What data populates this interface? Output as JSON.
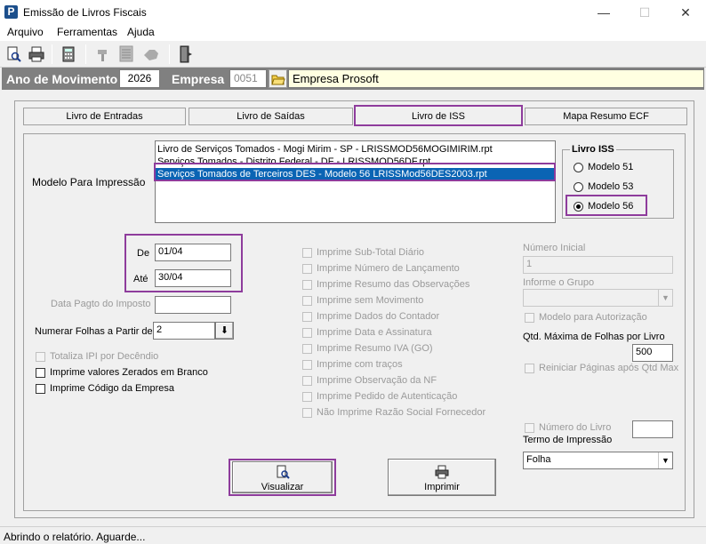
{
  "window": {
    "title": "Emissão de Livros Fiscais",
    "app_icon": "P",
    "minimize": "—",
    "maximize": "☐",
    "close": "✕"
  },
  "menu": [
    "Arquivo",
    "Ferramentas",
    "Ajuda"
  ],
  "toolbar": {
    "icons": [
      "preview-icon",
      "print-icon",
      "calculator-icon",
      "hammer-icon",
      "document-icon",
      "hand-icon",
      "exit-door-icon"
    ]
  },
  "header": {
    "ano_label": "Ano de Movimento",
    "ano_value": "2026",
    "empresa_label": "Empresa",
    "empresa_code": "0051",
    "empresa_name": "Empresa Prosoft"
  },
  "tabs": [
    "Livro de Entradas",
    "Livro de Saídas",
    "Livro de ISS",
    "Mapa Resumo ECF"
  ],
  "active_tab": "Livro de ISS",
  "modelo": {
    "label": "Modelo Para Impressão",
    "items": [
      "Livro de Serviços Tomados - Mogi Mirim - SP - LRISSMOD56MOGIMIRIM.rpt",
      "Serviços Tomados - Distrito Federal - DF - LRISSMOD56DF.rpt",
      "Serviços Tomados de Terceiros DES - Modelo 56  LRISSMod56DES2003.rpt"
    ],
    "selected_index": 2
  },
  "livro_iss": {
    "title": "Livro ISS",
    "options": [
      "Modelo 51",
      "Modelo 53",
      "Modelo 56"
    ],
    "selected": "Modelo 56"
  },
  "periodo": {
    "de_label": "De",
    "de_value": "01/04",
    "ate_label": "Até",
    "ate_value": "30/04"
  },
  "data_pagto": {
    "label": "Data Pagto do Imposto",
    "value": ""
  },
  "numerar": {
    "label": "Numerar Folhas a Partir de",
    "value": "2"
  },
  "left_checks": [
    {
      "label": "Totaliza IPI por Decêndio",
      "checked": false,
      "enabled": false
    },
    {
      "label": "Imprime valores Zerados em Branco",
      "checked": false,
      "enabled": true
    },
    {
      "label": "Imprime Código da Empresa",
      "checked": false,
      "enabled": true
    }
  ],
  "middle_checks": [
    "Imprime Sub-Total Diário",
    "Imprime Número de Lançamento",
    "Imprime Resumo das Observações",
    "Imprime sem Movimento",
    "Imprime Dados do Contador",
    "Imprime Data e Assinatura",
    "Imprime Resumo IVA (GO)",
    "Imprime com traços",
    "Imprime Observação da NF",
    "Imprime Pedido de Autenticação",
    "Não Imprime Razão Social Fornecedor"
  ],
  "right": {
    "numero_inicial_label": "Número Inicial",
    "numero_inicial_value": "1",
    "grupo_label": "Informe o Grupo",
    "grupo_value": "",
    "modelo_autorizacao": "Modelo para Autorização",
    "qtd_max_label": "Qtd. Máxima de Folhas por Livro",
    "qtd_max_value": "500",
    "reiniciar_label": "Reiniciar Páginas após Qtd Max",
    "numero_livro_label": "Número do Livro",
    "numero_livro_value": "",
    "termo_label": "Termo de Impressão",
    "termo_value": "Folha"
  },
  "buttons": {
    "visualizar": "Visualizar",
    "imprimir": "Imprimir"
  },
  "status": "Abrindo o relatório. Aguarde..."
}
